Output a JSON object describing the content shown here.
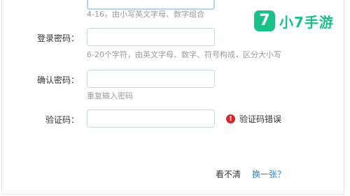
{
  "brand": {
    "icon_glyph": "7",
    "name": "小7手游",
    "color": "#19c08a"
  },
  "form": {
    "username_hint": "4-16，由小写英文字母、数字组合",
    "password_label": "登录密码：",
    "password_hint": "6-20个字符，由英文字母、数字、符号构成，区分大小写",
    "confirm_label": "确认密码：",
    "confirm_hint": "重复输入密码",
    "captcha_label": "验证码：",
    "captcha_error": "验证码错误",
    "cant_see": "看不清",
    "refresh": "换一张？"
  }
}
